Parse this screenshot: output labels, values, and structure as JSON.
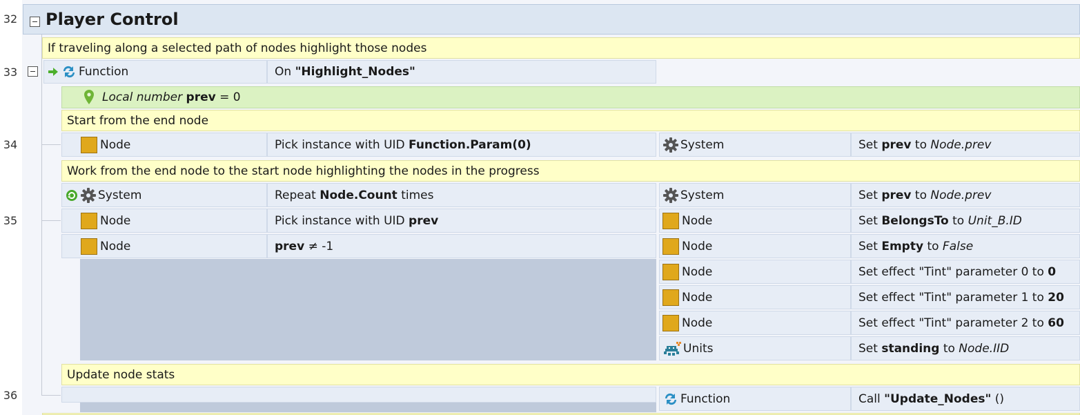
{
  "group": {
    "line": "32",
    "title": "Player Control"
  },
  "comments": {
    "c1": "If traveling along a selected path of nodes highlight those nodes",
    "c2": "Start from the end node",
    "c3": "Work from the end node to the start node highlighting the nodes in the progress",
    "c4": "Update node stats"
  },
  "lines": {
    "l33": "33",
    "l34": "34",
    "l35": "35",
    "l36": "36"
  },
  "event33": {
    "object": "Function",
    "prefix": "On ",
    "name": "\"Highlight_Nodes\""
  },
  "local_var": {
    "keyword": "Local number",
    "name": "prev",
    "rest": " = 0"
  },
  "event34": {
    "cond": {
      "object": "Node",
      "text": "Pick instance with UID ",
      "bold": "Function.Param(0)"
    },
    "action": {
      "object": "System",
      "text": "Set ",
      "bold": "prev",
      "mid": " to ",
      "ital": "Node.prev"
    }
  },
  "event35": {
    "conds": [
      {
        "object": "System",
        "text": "Repeat ",
        "bold": "Node.Count",
        "tail": " times"
      },
      {
        "object": "Node",
        "text": "Pick instance with UID ",
        "bold": "prev"
      },
      {
        "object": "Node",
        "bold": "prev",
        "tail": " ≠ -1"
      }
    ],
    "actions": [
      {
        "object": "System",
        "text": "Set ",
        "bold": "prev",
        "mid": " to ",
        "ital": "Node.prev"
      },
      {
        "object": "Node",
        "text": "Set ",
        "bold": "BelongsTo",
        "mid": " to ",
        "ital": "Unit_B.ID"
      },
      {
        "object": "Node",
        "text": "Set ",
        "bold": "Empty",
        "mid": " to ",
        "ital": "False"
      },
      {
        "object": "Node",
        "text": "Set effect \"Tint\" parameter 0 to ",
        "bold": "0"
      },
      {
        "object": "Node",
        "text": "Set effect \"Tint\" parameter 1 to ",
        "bold": "20"
      },
      {
        "object": "Node",
        "text": "Set effect \"Tint\" parameter 2 to ",
        "bold": "60"
      },
      {
        "object": "Units",
        "text": "Set ",
        "bold": "standing",
        "mid": " to ",
        "ital": "Node.IID"
      }
    ]
  },
  "event36": {
    "action": {
      "object": "Function",
      "text": "Call ",
      "bold": "\"Update_Nodes\"",
      "tail": " ()"
    }
  },
  "colors": {
    "object_icon": "#e0a81c",
    "comment_bg": "#ffffc8",
    "local_bg": "#dbf2c2",
    "group_bg": "#dce6f2",
    "row_bg": "#e7edf6",
    "empty_area": "#bfcadb"
  }
}
